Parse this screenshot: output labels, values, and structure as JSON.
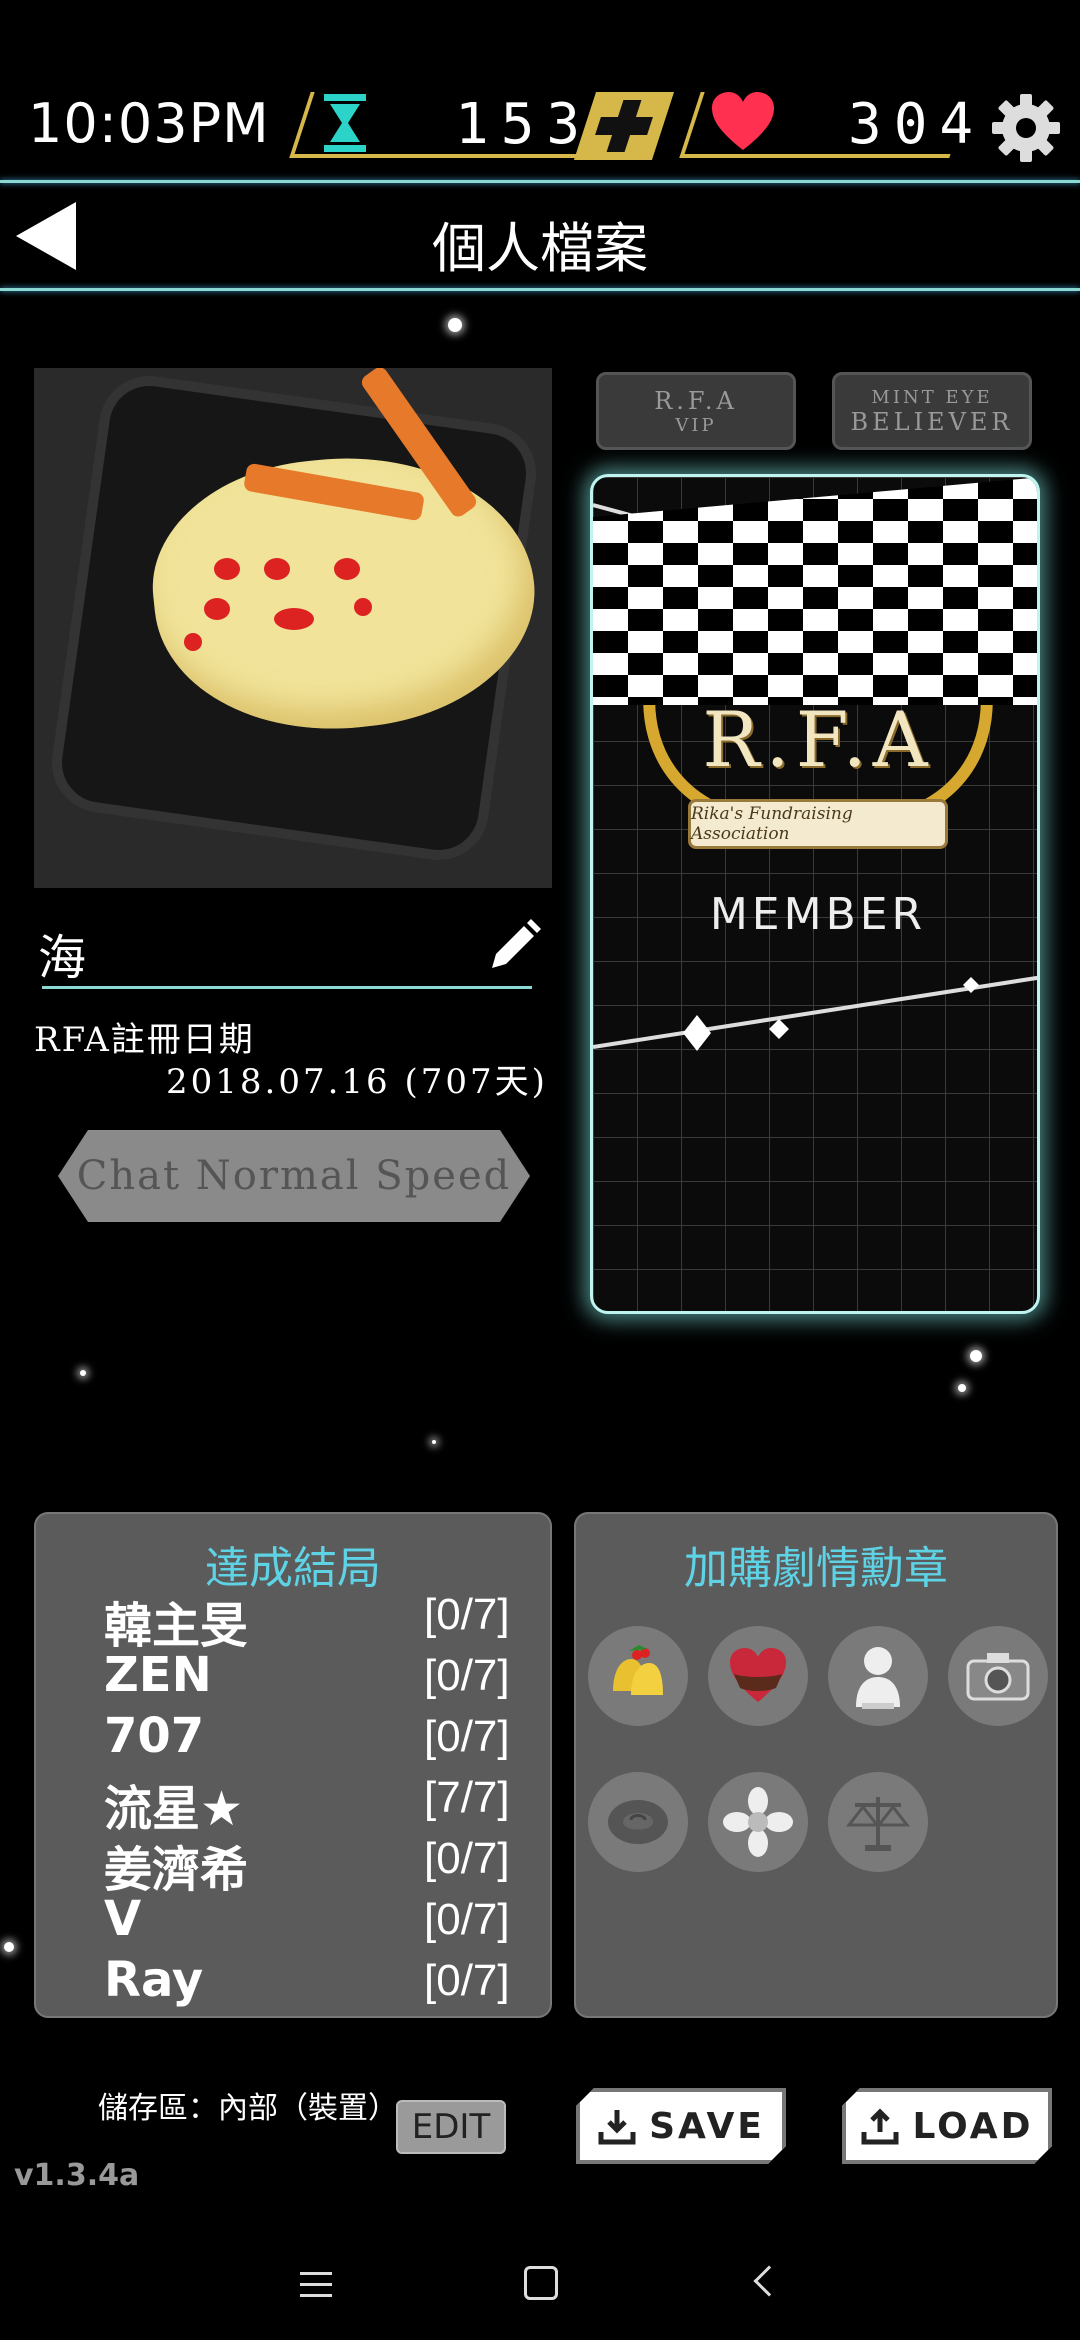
{
  "status": {
    "time": "10:03PM",
    "hourglass_count": "153",
    "heart_count": "304"
  },
  "header": {
    "title": "個人檔案"
  },
  "profile": {
    "name": "海",
    "reg_label": "RFA註冊日期",
    "reg_date": "2018.07.16 (707天)",
    "speed_label": "Chat Normal Speed"
  },
  "badges": {
    "vip_big": "R.F.A",
    "vip_small": "VIP",
    "believer_big": "MINT EYE",
    "believer_small": "BELIEVER"
  },
  "card": {
    "logo": "R.F.A",
    "banner": "Rika's Fundraising Association",
    "member": "MEMBER"
  },
  "endings": {
    "title": "達成結局",
    "items": [
      {
        "name": "韓主旻",
        "count": "[0/7]"
      },
      {
        "name": "ZEN",
        "count": "[0/7]"
      },
      {
        "name": "707",
        "count": "[0/7]"
      },
      {
        "name": "流星★",
        "count": "[7/7]"
      },
      {
        "name": "姜濟希",
        "count": "[0/7]"
      },
      {
        "name": "V",
        "count": "[0/7]"
      },
      {
        "name": "Ray",
        "count": "[0/7]"
      }
    ]
  },
  "medals": {
    "title": "加購劇情勳章",
    "icons": [
      "bells-icon",
      "chocolate-heart-icon",
      "bust-icon",
      "camera-icon",
      "rose-icon",
      "daffodil-icon",
      "scales-icon"
    ]
  },
  "footer": {
    "storage": "儲存區：內部（裝置）",
    "edit_label": "EDIT",
    "save_label": "SAVE",
    "load_label": "LOAD",
    "version": "v1.3.4a"
  },
  "colors": {
    "accent_cyan": "#8ad9d2",
    "gold": "#d6b84a",
    "heart": "#ff3050",
    "panel": "#5b5b5b",
    "panel_title": "#5ed3e6"
  }
}
